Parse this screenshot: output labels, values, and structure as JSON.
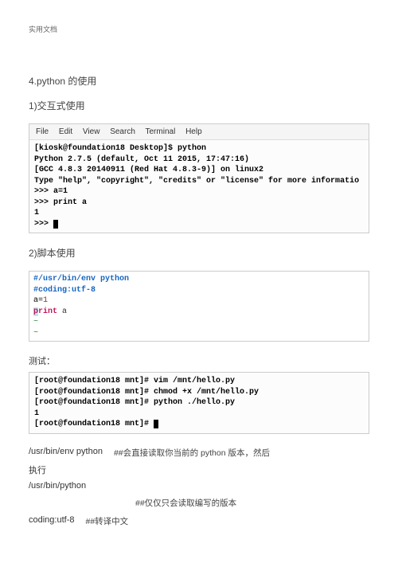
{
  "header": "实用文档",
  "sec4_title": "4.python 的使用",
  "sec4_sub1": "1)交互式使用",
  "term1": {
    "menu": [
      "File",
      "Edit",
      "View",
      "Search",
      "Terminal",
      "Help"
    ],
    "lines": [
      "[kiosk@foundation18 Desktop]$ python",
      "Python 2.7.5 (default, Oct 11 2015, 17:47:16)",
      "[GCC 4.8.3 20140911 (Red Hat 4.8.3-9)] on linux2",
      "Type \"help\", \"copyright\", \"credits\" or \"license\" for more informatio",
      ">>> a=1",
      ">>> print a",
      "1",
      ">>> "
    ]
  },
  "sec4_sub2": "2)脚本使用",
  "editor": {
    "shebang": "#/usr/bin/env python",
    "coding": "#coding:utf-8",
    "assign_left": "a=",
    "assign_val": "1",
    "print_first": "p",
    "print_rest": "rint",
    "print_var": " a",
    "tilde": "~"
  },
  "test_label": "测试：",
  "term2": {
    "lines": [
      "[root@foundation18 mnt]# vim /mnt/hello.py",
      "[root@foundation18 mnt]# chmod +x /mnt/hello.py",
      "[root@foundation18 mnt]# python ./hello.py",
      "1",
      "[root@foundation18 mnt]# "
    ]
  },
  "notes": {
    "path1": "/usr/bin/env python",
    "path1_desc": "##会直接读取你当前的 python 版本，然后",
    "execute": "执行",
    "path2": "/usr/bin/python",
    "path2_desc": "##仅仅只会读取编写的版本",
    "coding": "coding:utf-8",
    "coding_desc": "##转译中文"
  }
}
